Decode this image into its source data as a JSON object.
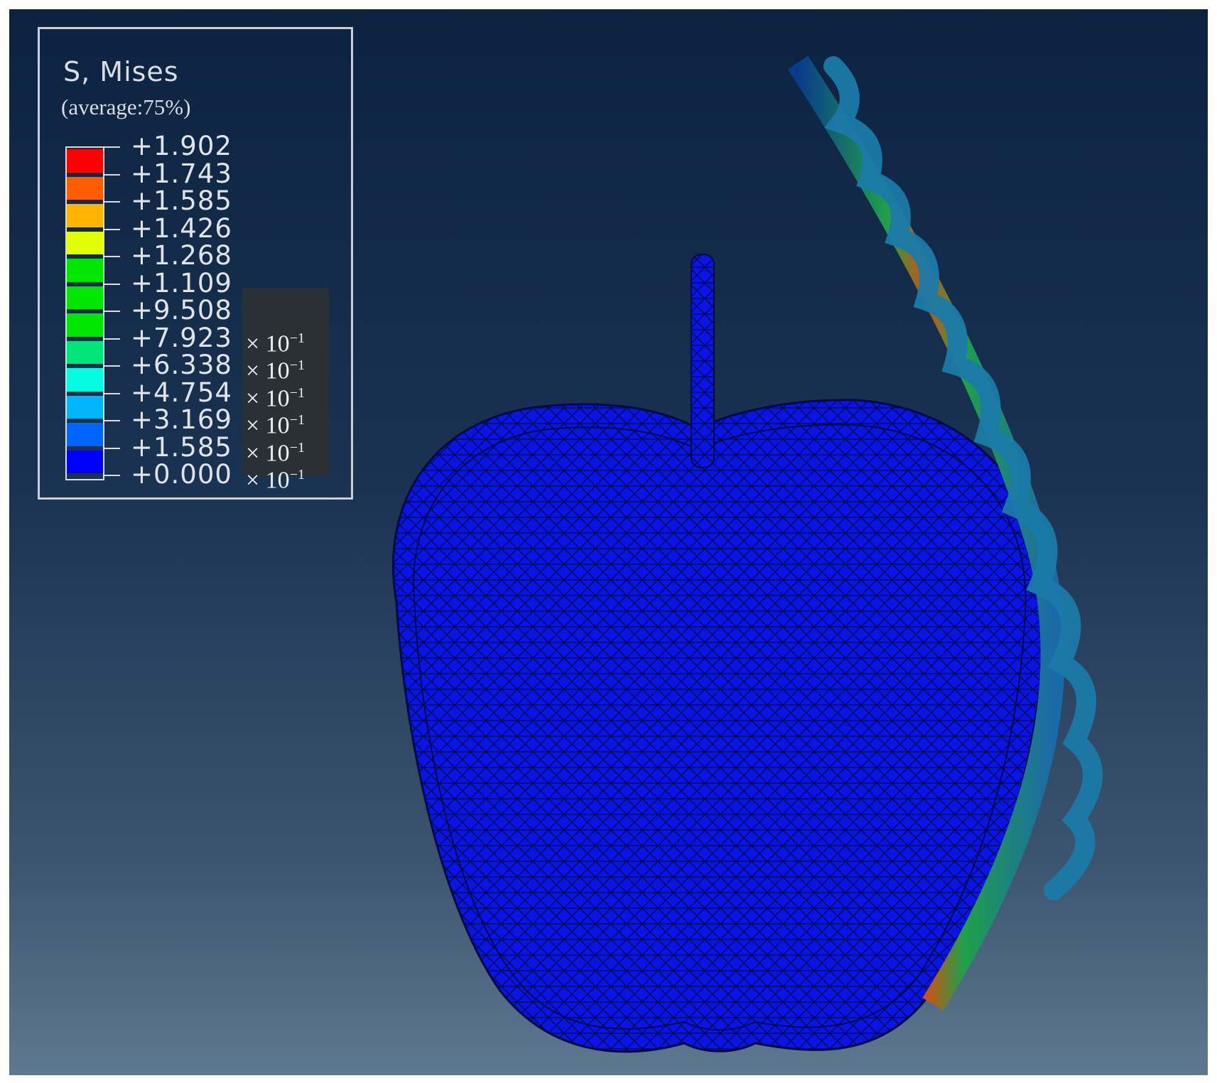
{
  "legend": {
    "title": "S, Mises",
    "subtitle": "(average:75%)",
    "values": [
      "+1.902",
      "+1.743",
      "+1.585",
      "+1.426",
      "+1.268",
      "+1.109",
      "+9.508",
      "+7.923",
      "+6.338",
      "+4.754",
      "+3.169",
      "+1.585",
      "+0.000"
    ],
    "multiplier_base": "× 10",
    "multiplier_exp": "−1",
    "multiplied_rows": 6,
    "colors": [
      "#ff0000",
      "#ff5e00",
      "#ffb400",
      "#e0ff00",
      "#00e600",
      "#00e600",
      "#00e600",
      "#00e67a",
      "#00ffe0",
      "#00b4ff",
      "#0064ff",
      "#0000ff"
    ]
  },
  "model": {
    "fruit_color": "#0a14e6",
    "mesh_color": "#050a40"
  }
}
